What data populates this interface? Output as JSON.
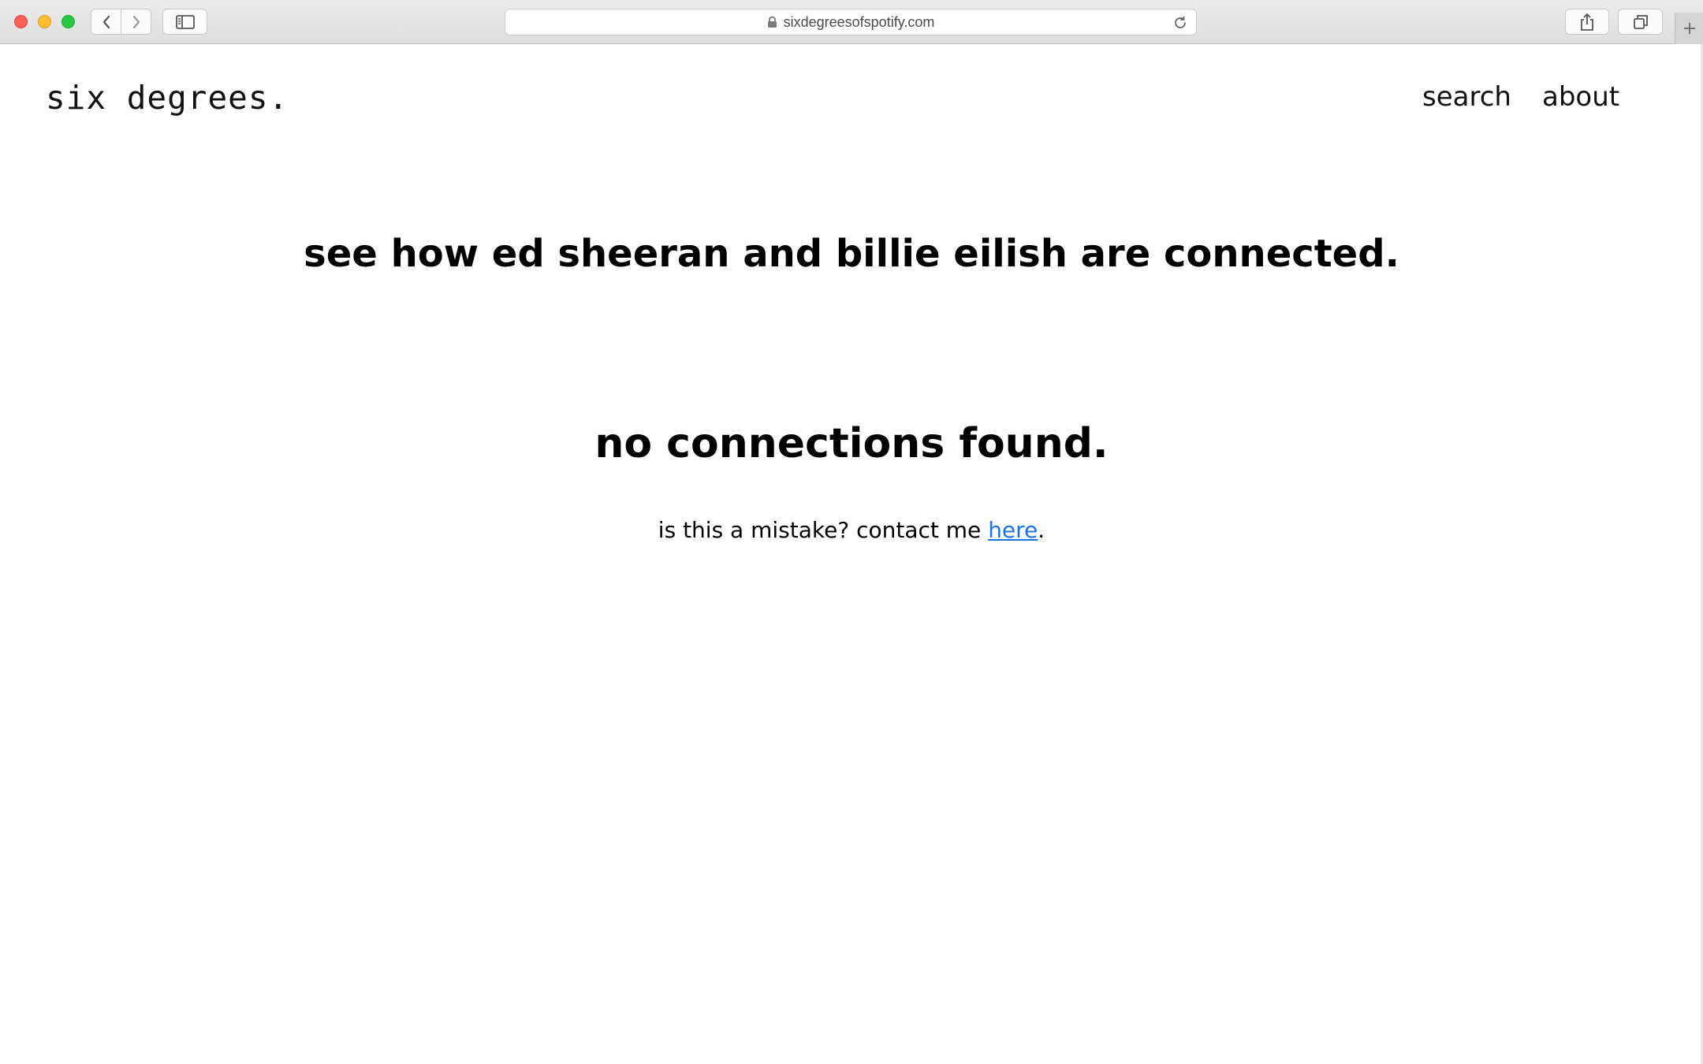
{
  "browser": {
    "url": "sixdegreesofspotify.com"
  },
  "site": {
    "logo": "six degrees.",
    "nav": {
      "search": "search",
      "about": "about"
    },
    "heading": "see how ed sheeran and billie eilish are connected.",
    "result": "no connections found.",
    "contact": {
      "prefix": "is this a mistake? contact me ",
      "link": "here",
      "suffix": "."
    }
  },
  "colors": {
    "link": "#1a73e8",
    "close": "#fe5f57",
    "minimize": "#febc2e",
    "maximize": "#28c840"
  }
}
